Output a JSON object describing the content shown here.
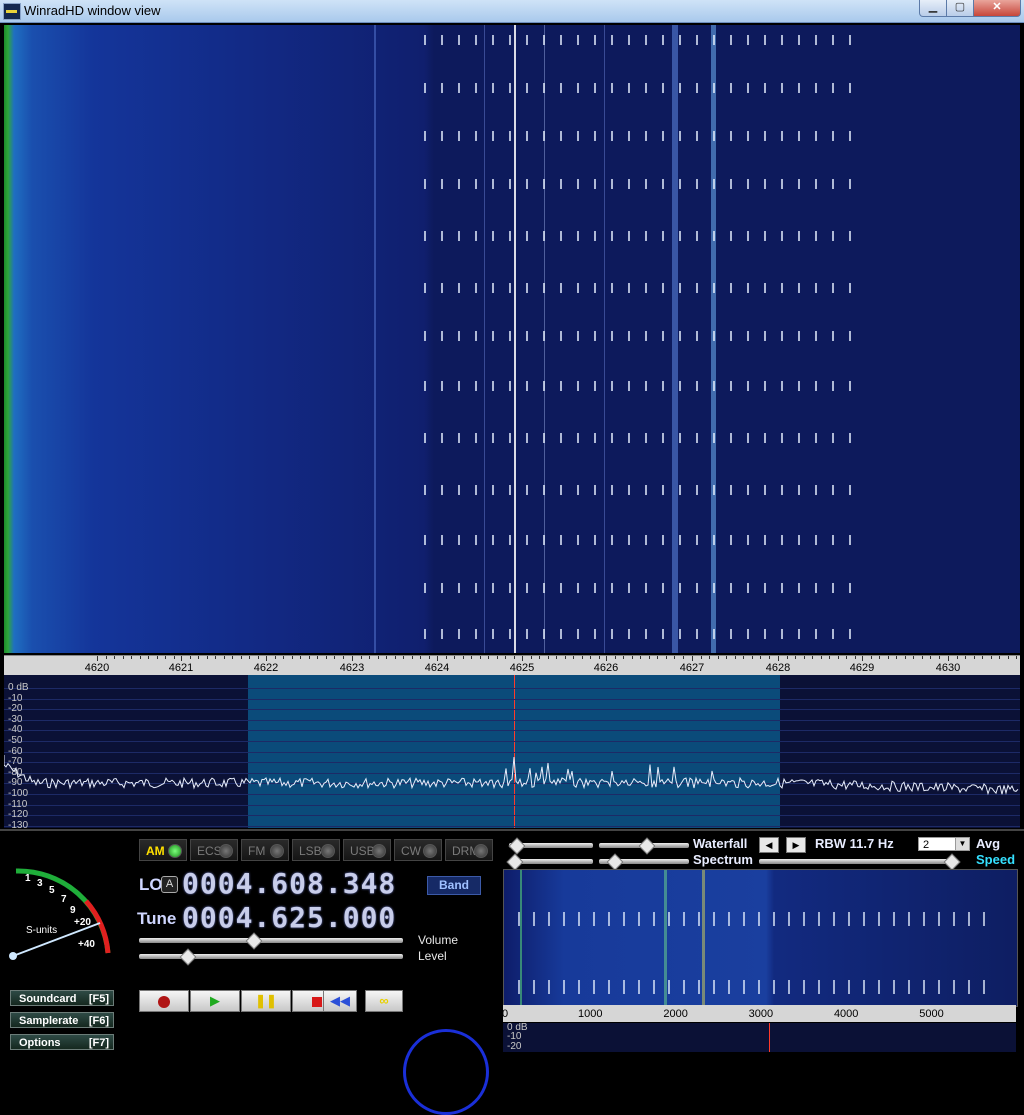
{
  "window": {
    "title": "WinradHD window view",
    "min_icon": "minimize-icon",
    "max_icon": "maximize-icon",
    "close_label": "✕"
  },
  "freq_axis": {
    "labels": [
      "4620",
      "4621",
      "4622",
      "4623",
      "4624",
      "4625",
      "4626",
      "4627",
      "4628",
      "4629",
      "4630"
    ]
  },
  "spectrum": {
    "db_labels": [
      "0  dB",
      "-10",
      "-20",
      "-30",
      "-40",
      "-50",
      "-60",
      "-70",
      "-80",
      "-90",
      "-100",
      "-110",
      "-120",
      "-130"
    ]
  },
  "smeter": {
    "title": "S-units",
    "scale": [
      "1",
      "3",
      "5",
      "7",
      "9",
      "+20",
      "+40"
    ]
  },
  "side_buttons": [
    {
      "label": "Soundcard",
      "key": "[F5]"
    },
    {
      "label": "Samplerate",
      "key": "[F6]"
    },
    {
      "label": "Options",
      "key": "[F7]"
    }
  ],
  "modes": [
    {
      "label": "AM",
      "active": true
    },
    {
      "label": "ECSS",
      "active": false
    },
    {
      "label": "FM",
      "active": false
    },
    {
      "label": "LSB",
      "active": false
    },
    {
      "label": "USB",
      "active": false
    },
    {
      "label": "CW",
      "active": false
    },
    {
      "label": "DRM",
      "active": false
    }
  ],
  "lo": {
    "label": "LO",
    "badge": "A",
    "value": "0004.608.348"
  },
  "tune": {
    "label": "Tune",
    "value": "0004.625.000"
  },
  "band_button": "Band",
  "volume": {
    "label": "Volume",
    "level_label": "Level",
    "volume_value": 0.43,
    "level_value": 0.18
  },
  "transport": [
    "record-icon",
    "play-icon",
    "pause-icon",
    "stop-icon",
    "rewind-icon",
    "loop-icon"
  ],
  "waterfall_ctrl": {
    "waterfall_label": "Waterfall",
    "spectrum_label": "Spectrum",
    "rbw": "RBW 11.7 Hz",
    "avg_value": "2",
    "avg_label": "Avg",
    "speed_label": "Speed"
  },
  "mini_axis": {
    "labels": [
      "0",
      "1000",
      "2000",
      "3000",
      "4000",
      "5000"
    ]
  },
  "mini_spec": {
    "db_labels": [
      "0  dB",
      "-10",
      "-20"
    ]
  },
  "colors": {
    "accent_yellow": "#ffe000",
    "tune_marker": "#ff3a2a",
    "passband": "#0b4b7a",
    "speed_label": "#35e0ff"
  }
}
